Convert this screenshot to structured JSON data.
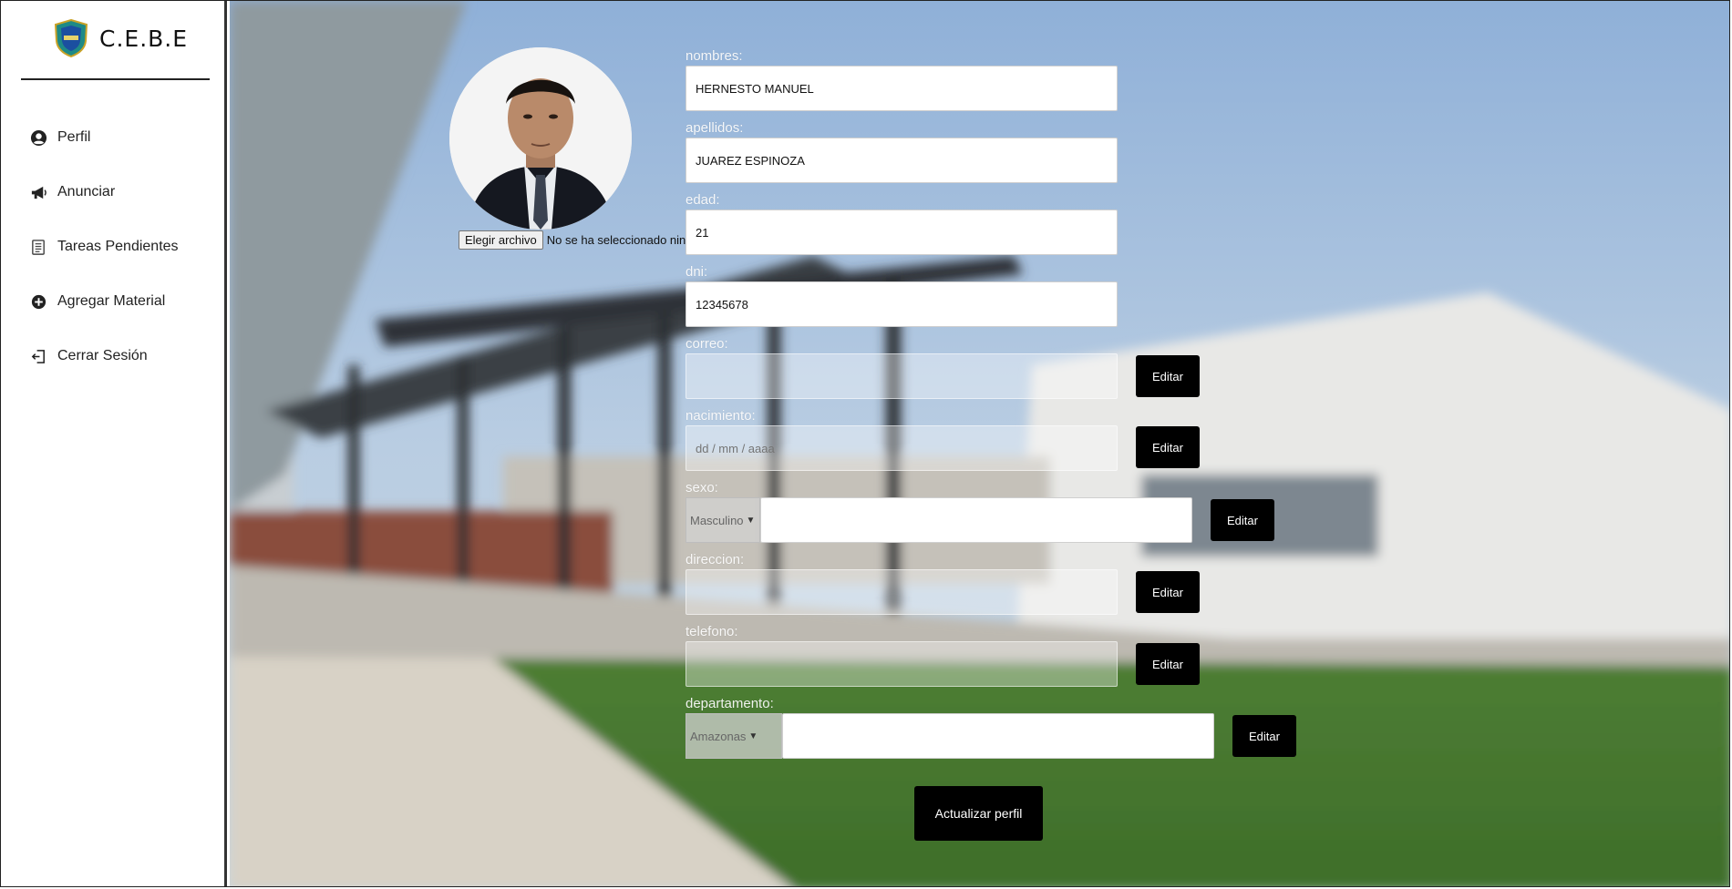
{
  "brand": {
    "name": "C.E.B.E"
  },
  "sidebar": {
    "items": [
      {
        "label": "Perfil",
        "icon": "user-circle-icon"
      },
      {
        "label": "Anunciar",
        "icon": "megaphone-icon"
      },
      {
        "label": "Tareas Pendientes",
        "icon": "tasks-icon"
      },
      {
        "label": "Agregar Material",
        "icon": "plus-circle-icon"
      },
      {
        "label": "Cerrar Sesión",
        "icon": "logout-icon"
      }
    ]
  },
  "profile": {
    "file_button": "Elegir archivo",
    "file_status": "No se ha seleccionado ningún archivo",
    "fields": {
      "nombres": {
        "label": "nombres:",
        "value": "HERNESTO MANUEL"
      },
      "apellidos": {
        "label": "apellidos:",
        "value": "JUAREZ ESPINOZA"
      },
      "edad": {
        "label": "edad:",
        "value": "21"
      },
      "dni": {
        "label": "dni:",
        "value": "12345678"
      },
      "correo": {
        "label": "correo:",
        "value": ""
      },
      "nacimiento": {
        "label": "nacimiento:",
        "placeholder": "dd / mm / aaaa"
      },
      "sexo": {
        "label": "sexo:",
        "selected": "Masculino",
        "value": ""
      },
      "direccion": {
        "label": "direccion:",
        "value": ""
      },
      "telefono": {
        "label": "telefono:",
        "value": ""
      },
      "departamento": {
        "label": "departamento:",
        "selected": "Amazonas",
        "value": ""
      }
    },
    "edit_label": "Editar",
    "update_label": "Actualizar perfil"
  },
  "colors": {
    "accent": "#000000",
    "sidebar_bg": "#ffffff"
  }
}
